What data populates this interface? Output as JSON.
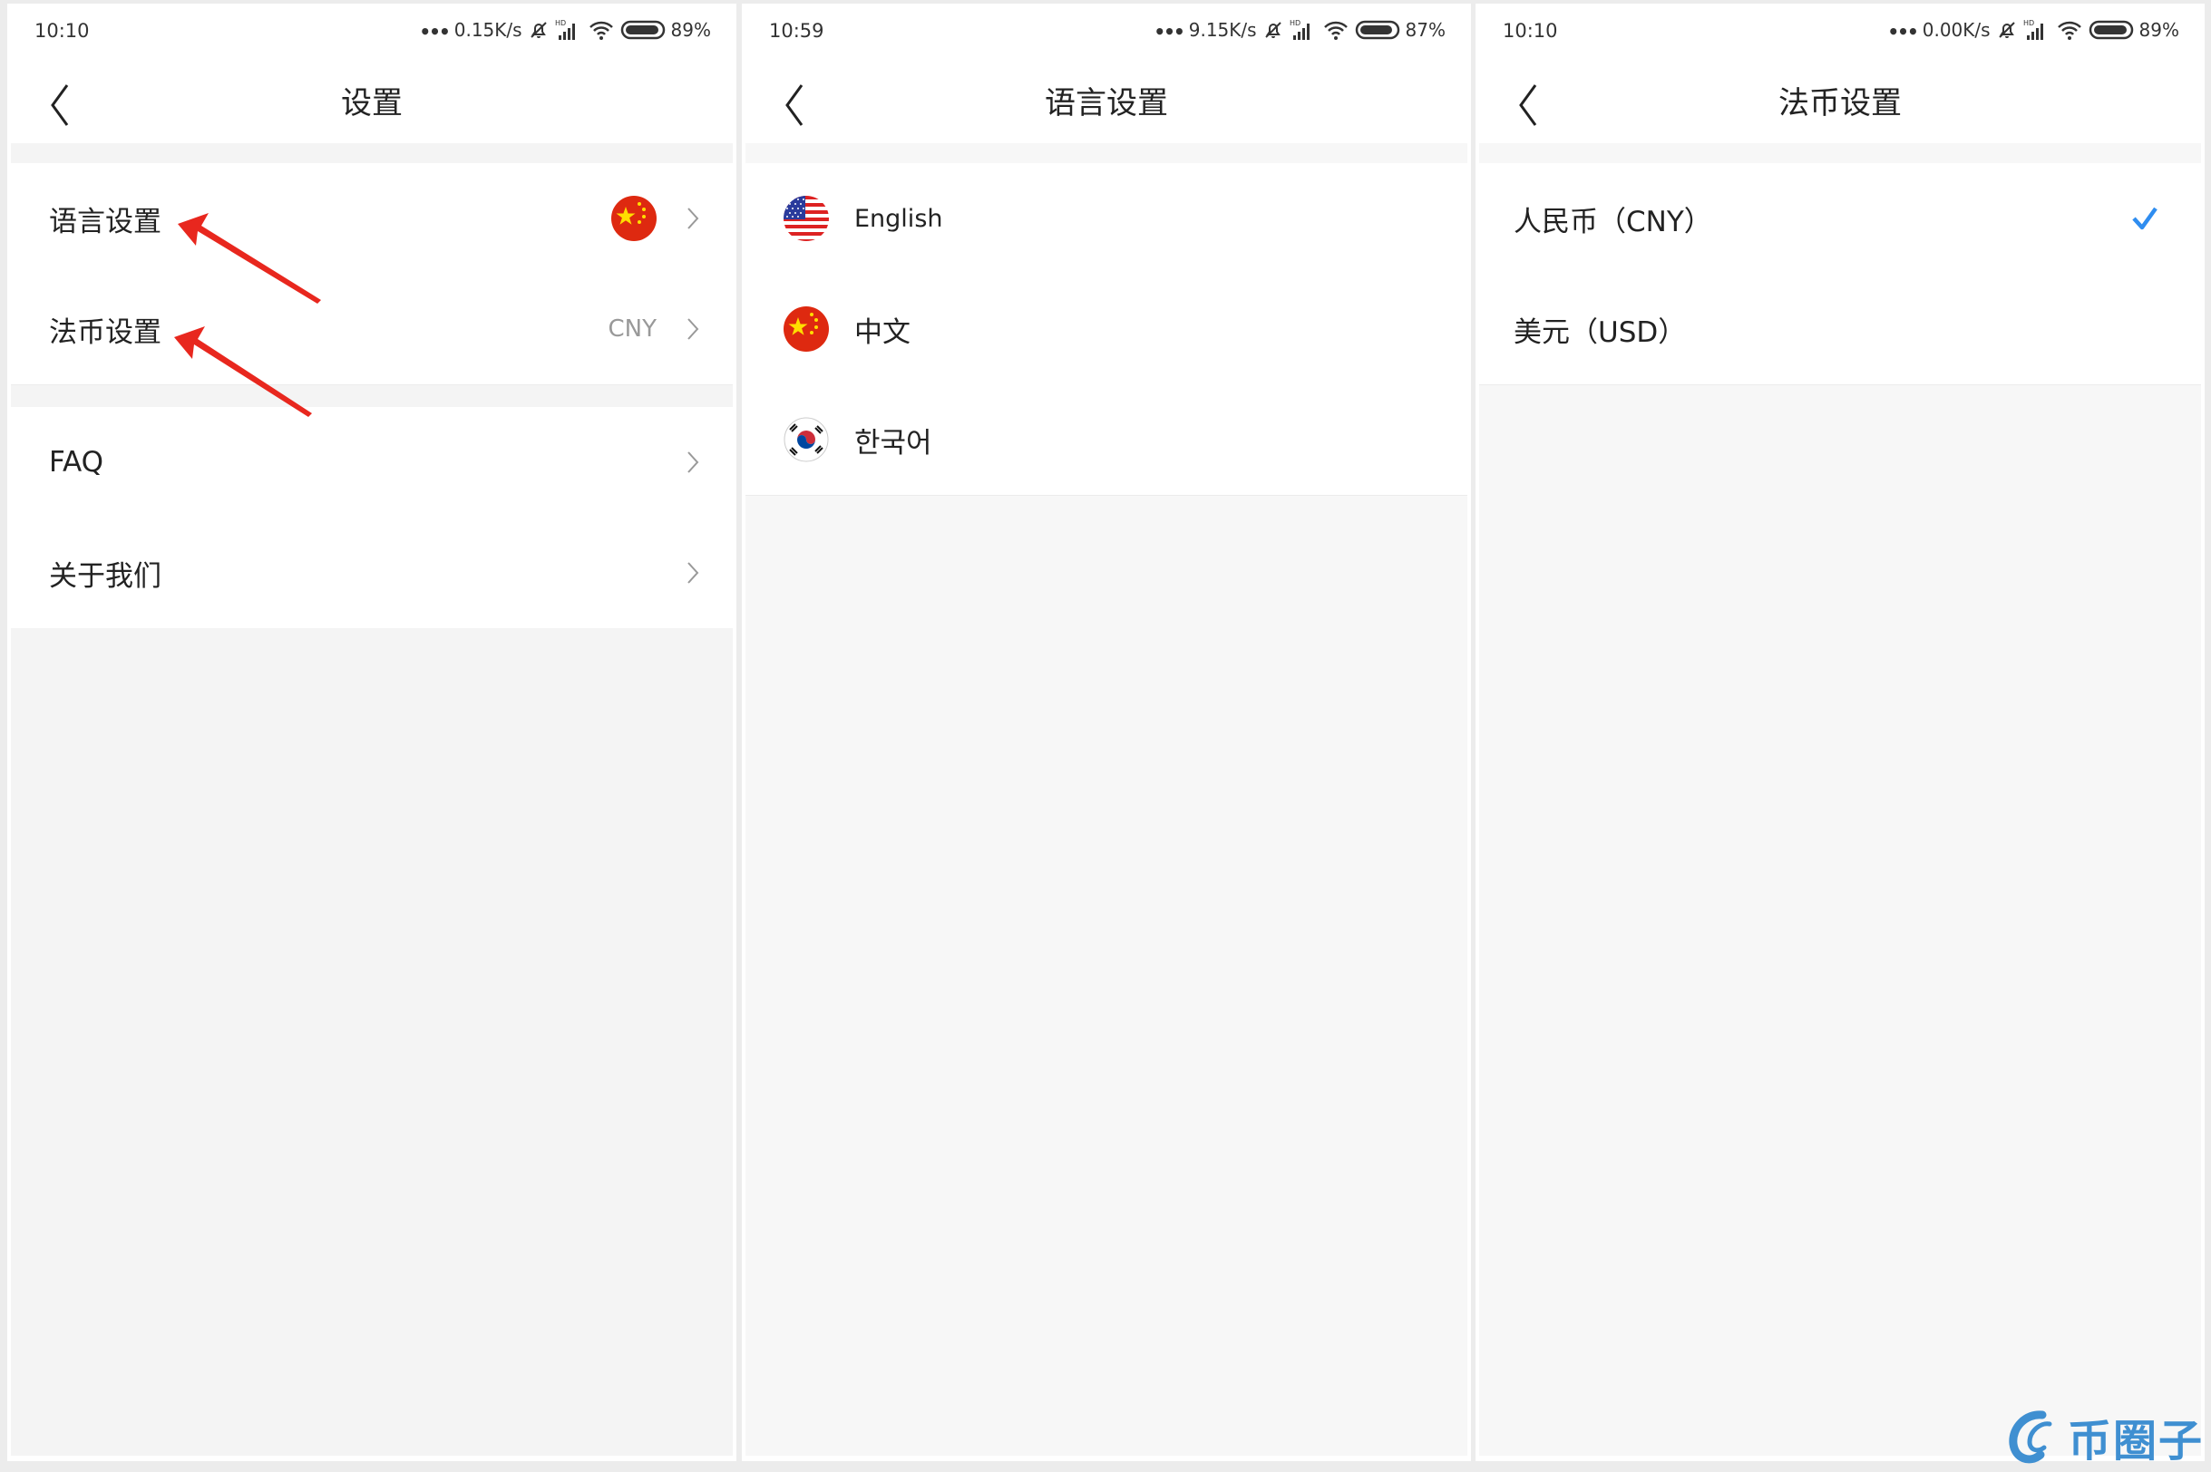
{
  "screens": [
    {
      "status": {
        "time": "10:10",
        "speed": "0.15K/s",
        "battery": "89%",
        "network": "HD"
      },
      "title": "设置",
      "rows": [
        {
          "label": "语言设置",
          "flag": "china-flag",
          "annotated": true
        },
        {
          "label": "法币设置",
          "value": "CNY",
          "annotated": true
        },
        {
          "label": "FAQ"
        },
        {
          "label": "关于我们"
        }
      ]
    },
    {
      "status": {
        "time": "10:59",
        "speed": "9.15K/s",
        "battery": "87%",
        "network": "HD"
      },
      "title": "语言设置",
      "languages": [
        {
          "label": "English",
          "flag": "us-flag"
        },
        {
          "label": "中文",
          "flag": "china-flag"
        },
        {
          "label": "한국어",
          "flag": "korea-flag"
        }
      ]
    },
    {
      "status": {
        "time": "10:10",
        "speed": "0.00K/s",
        "battery": "89%",
        "network": "HD"
      },
      "title": "法币设置",
      "currencies": [
        {
          "label": "人民币（CNY）",
          "selected": true
        },
        {
          "label": "美元（USD）",
          "selected": false
        }
      ]
    }
  ],
  "colors": {
    "accent_check": "#2f8df0",
    "annotation_arrow": "#e8271e",
    "watermark": "#3f8fd1"
  },
  "watermark": {
    "text": "币圈子"
  }
}
